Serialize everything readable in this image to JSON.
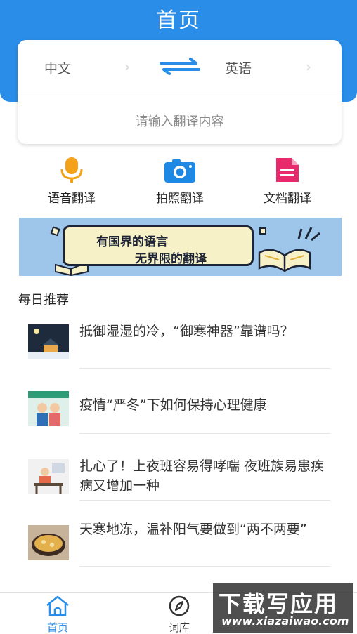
{
  "header": {
    "title": "首页"
  },
  "translator": {
    "source_lang": "中文",
    "target_lang": "英语",
    "input_placeholder": "请输入翻译内容"
  },
  "tools": [
    {
      "label": "语音翻译",
      "icon": "microphone-icon"
    },
    {
      "label": "拍照翻译",
      "icon": "camera-icon"
    },
    {
      "label": "文档翻译",
      "icon": "document-icon"
    }
  ],
  "banner": {
    "line1": "有国界的语言",
    "line2": "无界限的翻译"
  },
  "section": {
    "title": "每日推荐"
  },
  "news": [
    {
      "title": "抵御湿湿的冷，“御寒神器”靠谱吗？"
    },
    {
      "title": "疫情“严冬”下如何保持心理健康"
    },
    {
      "title": "扎心了！上夜班容易得哮喘 夜班族易患疾病又增加一种"
    },
    {
      "title": "天寒地冻，温补阳气要做到“两不两要”"
    }
  ],
  "tabbar": [
    {
      "label": "首页",
      "icon": "home-icon",
      "active": true
    },
    {
      "label": "词库",
      "icon": "compass-icon",
      "active": false
    }
  ],
  "watermark": {
    "main": "下载写应用",
    "url": "www.xiazaiwao.com"
  },
  "colors": {
    "primary": "#2a8de8",
    "voice": "#f5a21b",
    "camera": "#1e88e5",
    "document": "#e8296b"
  }
}
